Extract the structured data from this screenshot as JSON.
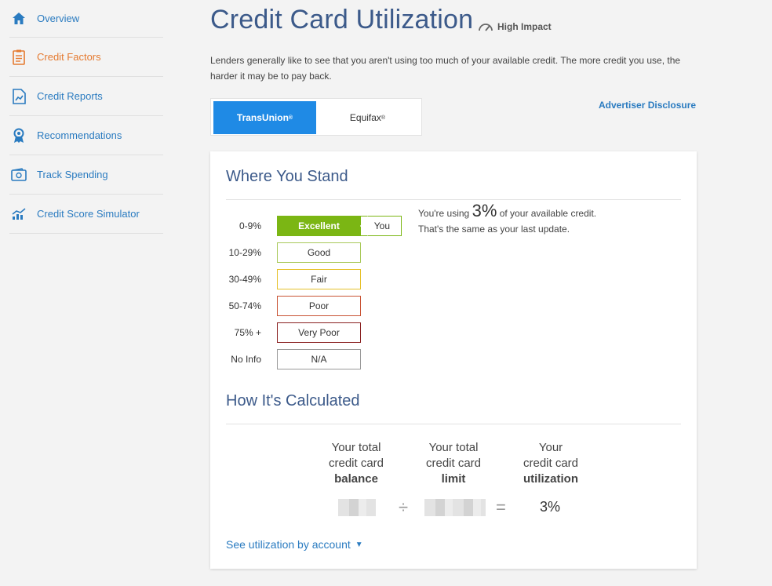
{
  "sidebar": {
    "items": [
      {
        "label": "Overview",
        "icon": "home-icon"
      },
      {
        "label": "Credit Factors",
        "icon": "clipboard-icon"
      },
      {
        "label": "Credit Reports",
        "icon": "report-icon"
      },
      {
        "label": "Recommendations",
        "icon": "ribbon-icon"
      },
      {
        "label": "Track Spending",
        "icon": "wallet-icon"
      },
      {
        "label": "Credit Score Simulator",
        "icon": "chart-icon"
      }
    ]
  },
  "header": {
    "title": "Credit Card Utilization",
    "impact": "High Impact",
    "intro": "Lenders generally like to see that you aren't using too much of your available credit. The more credit you use, the harder it may be to pay back."
  },
  "tabs": [
    {
      "label": "TransUnion",
      "mark": "®"
    },
    {
      "label": "Equifax",
      "mark": "®"
    }
  ],
  "disclosure": "Advertiser Disclosure",
  "where_you_stand": {
    "title": "Where You Stand",
    "you_label": "You",
    "summary_prefix": "You're using",
    "summary_value": "3%",
    "summary_suffix": "of your available credit.",
    "summary_line2": "That's the same as your last update.",
    "scale": [
      {
        "range": "0-9%",
        "rating": "Excellent"
      },
      {
        "range": "10-29%",
        "rating": "Good"
      },
      {
        "range": "30-49%",
        "rating": "Fair"
      },
      {
        "range": "50-74%",
        "rating": "Poor"
      },
      {
        "range": "75% +",
        "rating": "Very Poor"
      },
      {
        "range": "No Info",
        "rating": "N/A"
      }
    ]
  },
  "calculated": {
    "title": "How It's Calculated",
    "col1": {
      "line1": "Your total",
      "line2": "credit card",
      "bold": "balance"
    },
    "col2": {
      "line1": "Your total",
      "line2": "credit card",
      "bold": "limit"
    },
    "col3": {
      "line1": "Your",
      "line2": "credit card",
      "bold": "utilization"
    },
    "divide": "÷",
    "equals": "=",
    "result": "3%",
    "see_link": "See utilization by account"
  }
}
